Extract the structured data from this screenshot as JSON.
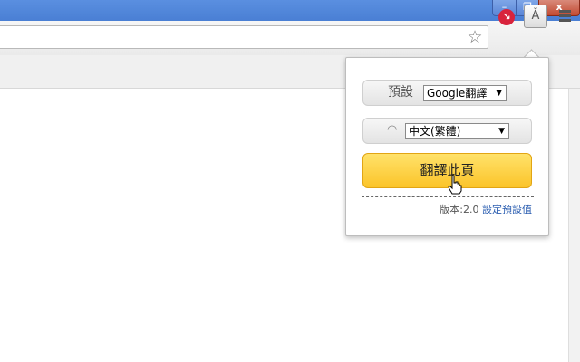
{
  "window": {
    "controls": {
      "minimize": "–",
      "maximize": "❐",
      "close": "x"
    }
  },
  "toolbar": {
    "star_icon": "☆",
    "extensions": [
      {
        "name": "red-ext-icon",
        "glyph": "↘",
        "color": "#d8233c"
      },
      {
        "name": "translate-ext-icon",
        "glyph": "Ǎ"
      }
    ]
  },
  "popup": {
    "engine_label": "預設",
    "engine_value": "Google翻譯",
    "language_value": "中文(繁體)",
    "select_arrow": "▼",
    "refresh_glyph": "◠",
    "translate_button": "翻譯此頁",
    "version_label": "版本:2.0",
    "settings_link": "設定預設值",
    "accent_color": "#fbc42a",
    "link_color": "#2a5db0"
  }
}
